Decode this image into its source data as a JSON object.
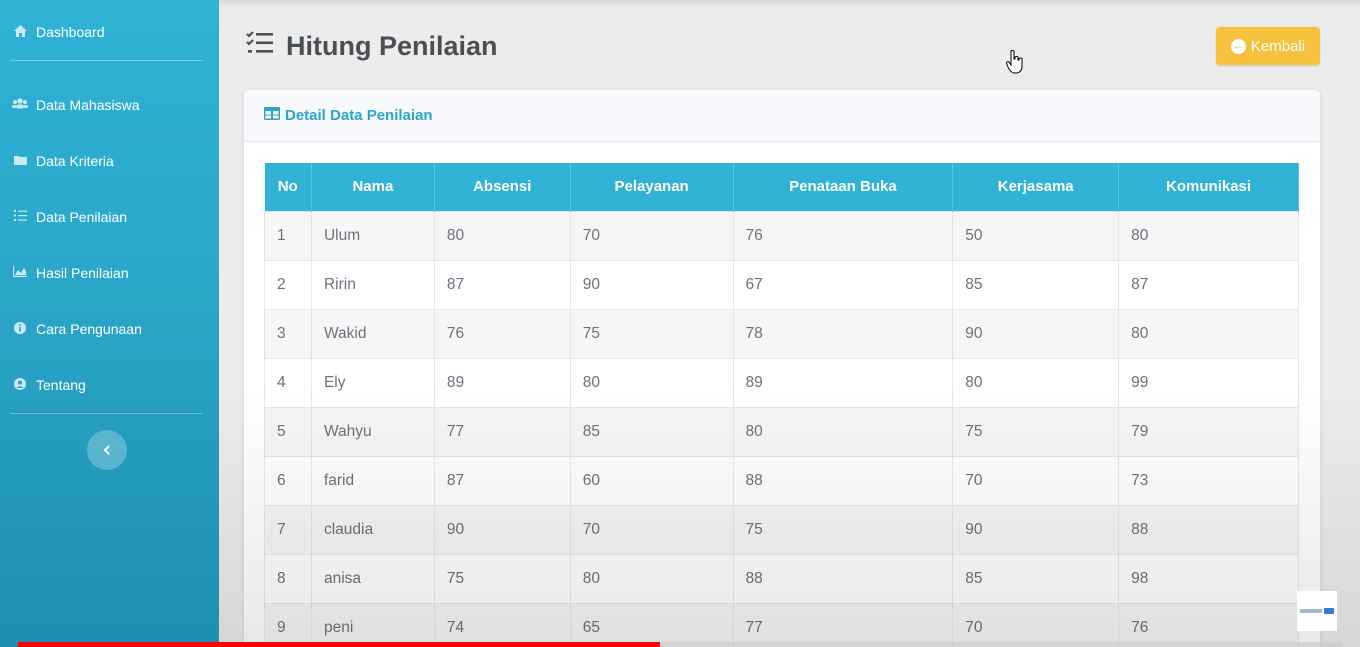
{
  "sidebar": {
    "items": [
      {
        "label": "Dashboard",
        "icon": "home-icon"
      },
      {
        "label": "Data Mahasiswa",
        "icon": "users-icon"
      },
      {
        "label": "Data Kriteria",
        "icon": "folder-icon"
      },
      {
        "label": "Data Penilaian",
        "icon": "list-icon"
      },
      {
        "label": "Hasil Penilaian",
        "icon": "chart-area-icon"
      },
      {
        "label": "Cara Pengunaan",
        "icon": "info-circle-icon"
      },
      {
        "label": "Tentang",
        "icon": "user-circle-icon"
      }
    ],
    "toggle_icon": "chevron-left-icon"
  },
  "header": {
    "title": "Hitung Penilaian",
    "title_icon": "tasks-icon",
    "back_label": "Kembali",
    "back_icon": "arrow-circle-left-icon"
  },
  "card": {
    "title": "Detail Data Penilaian",
    "title_icon": "table-icon"
  },
  "table": {
    "headers": [
      "No",
      "Nama",
      "Absensi",
      "Pelayanan",
      "Penataan Buka",
      "Kerjasama",
      "Komunikasi"
    ],
    "rows": [
      [
        "1",
        "Ulum",
        "80",
        "70",
        "76",
        "50",
        "80"
      ],
      [
        "2",
        "Ririn",
        "87",
        "90",
        "67",
        "85",
        "87"
      ],
      [
        "3",
        "Wakid",
        "76",
        "75",
        "78",
        "90",
        "80"
      ],
      [
        "4",
        "Ely",
        "89",
        "80",
        "89",
        "80",
        "99"
      ],
      [
        "5",
        "Wahyu",
        "77",
        "85",
        "80",
        "75",
        "79"
      ],
      [
        "6",
        "farid",
        "87",
        "60",
        "88",
        "70",
        "73"
      ],
      [
        "7",
        "claudia",
        "90",
        "70",
        "75",
        "90",
        "88"
      ],
      [
        "8",
        "anisa",
        "75",
        "80",
        "88",
        "85",
        "98"
      ],
      [
        "9",
        "peni",
        "74",
        "65",
        "77",
        "70",
        "76"
      ]
    ]
  },
  "video": {
    "progress": 0.485
  },
  "colors": {
    "sidebar": "#2fb2d6",
    "table_header": "#2fb2d6",
    "back_button": "#f6c23e",
    "progress": "#ff0000"
  }
}
